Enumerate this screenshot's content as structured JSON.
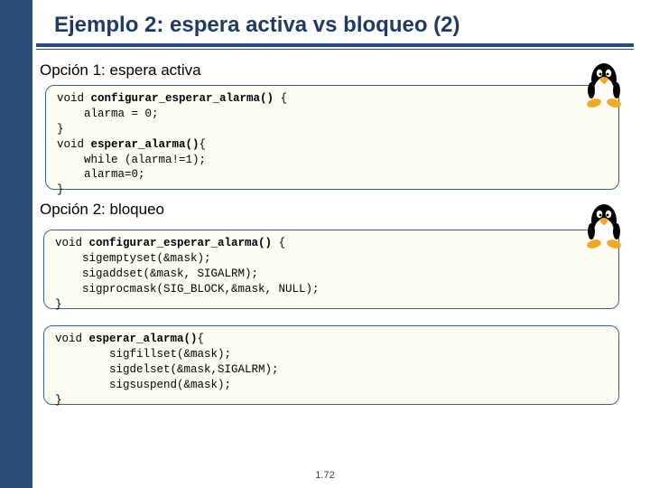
{
  "title": "Ejemplo 2: espera activa vs bloqueo (2)",
  "section1": "Opción 1: espera activa",
  "section2": "Opción 2: bloqueo",
  "code1": {
    "l1a": "void ",
    "l1b": "configurar_esperar_alarma()",
    "l1c": " {",
    "l2": "    alarma = 0;",
    "l3": "}",
    "l4a": "void ",
    "l4b": "esperar_alarma()",
    "l4c": "{",
    "l5": "    while (alarma!=1);",
    "l6": "    alarma=0;",
    "l7": "}"
  },
  "code2": {
    "l1a": "void ",
    "l1b": "configurar_esperar_alarma()",
    "l1c": " {",
    "l2": "    sigemptyset(&mask);",
    "l3": "    sigaddset(&mask, SIGALRM);",
    "l4": "    sigprocmask(SIG_BLOCK,&mask, NULL);",
    "l5": "}"
  },
  "code3": {
    "l1a": "void ",
    "l1b": "esperar_alarma()",
    "l1c": "{",
    "l2": "        sigfillset(&mask);",
    "l3": "        sigdelset(&mask,SIGALRM);",
    "l4": "        sigsuspend(&mask);",
    "l5": "}"
  },
  "pagenum": "1.72",
  "icons": {
    "tux1": "tux-penguin-icon",
    "tux2": "tux-penguin-icon"
  }
}
